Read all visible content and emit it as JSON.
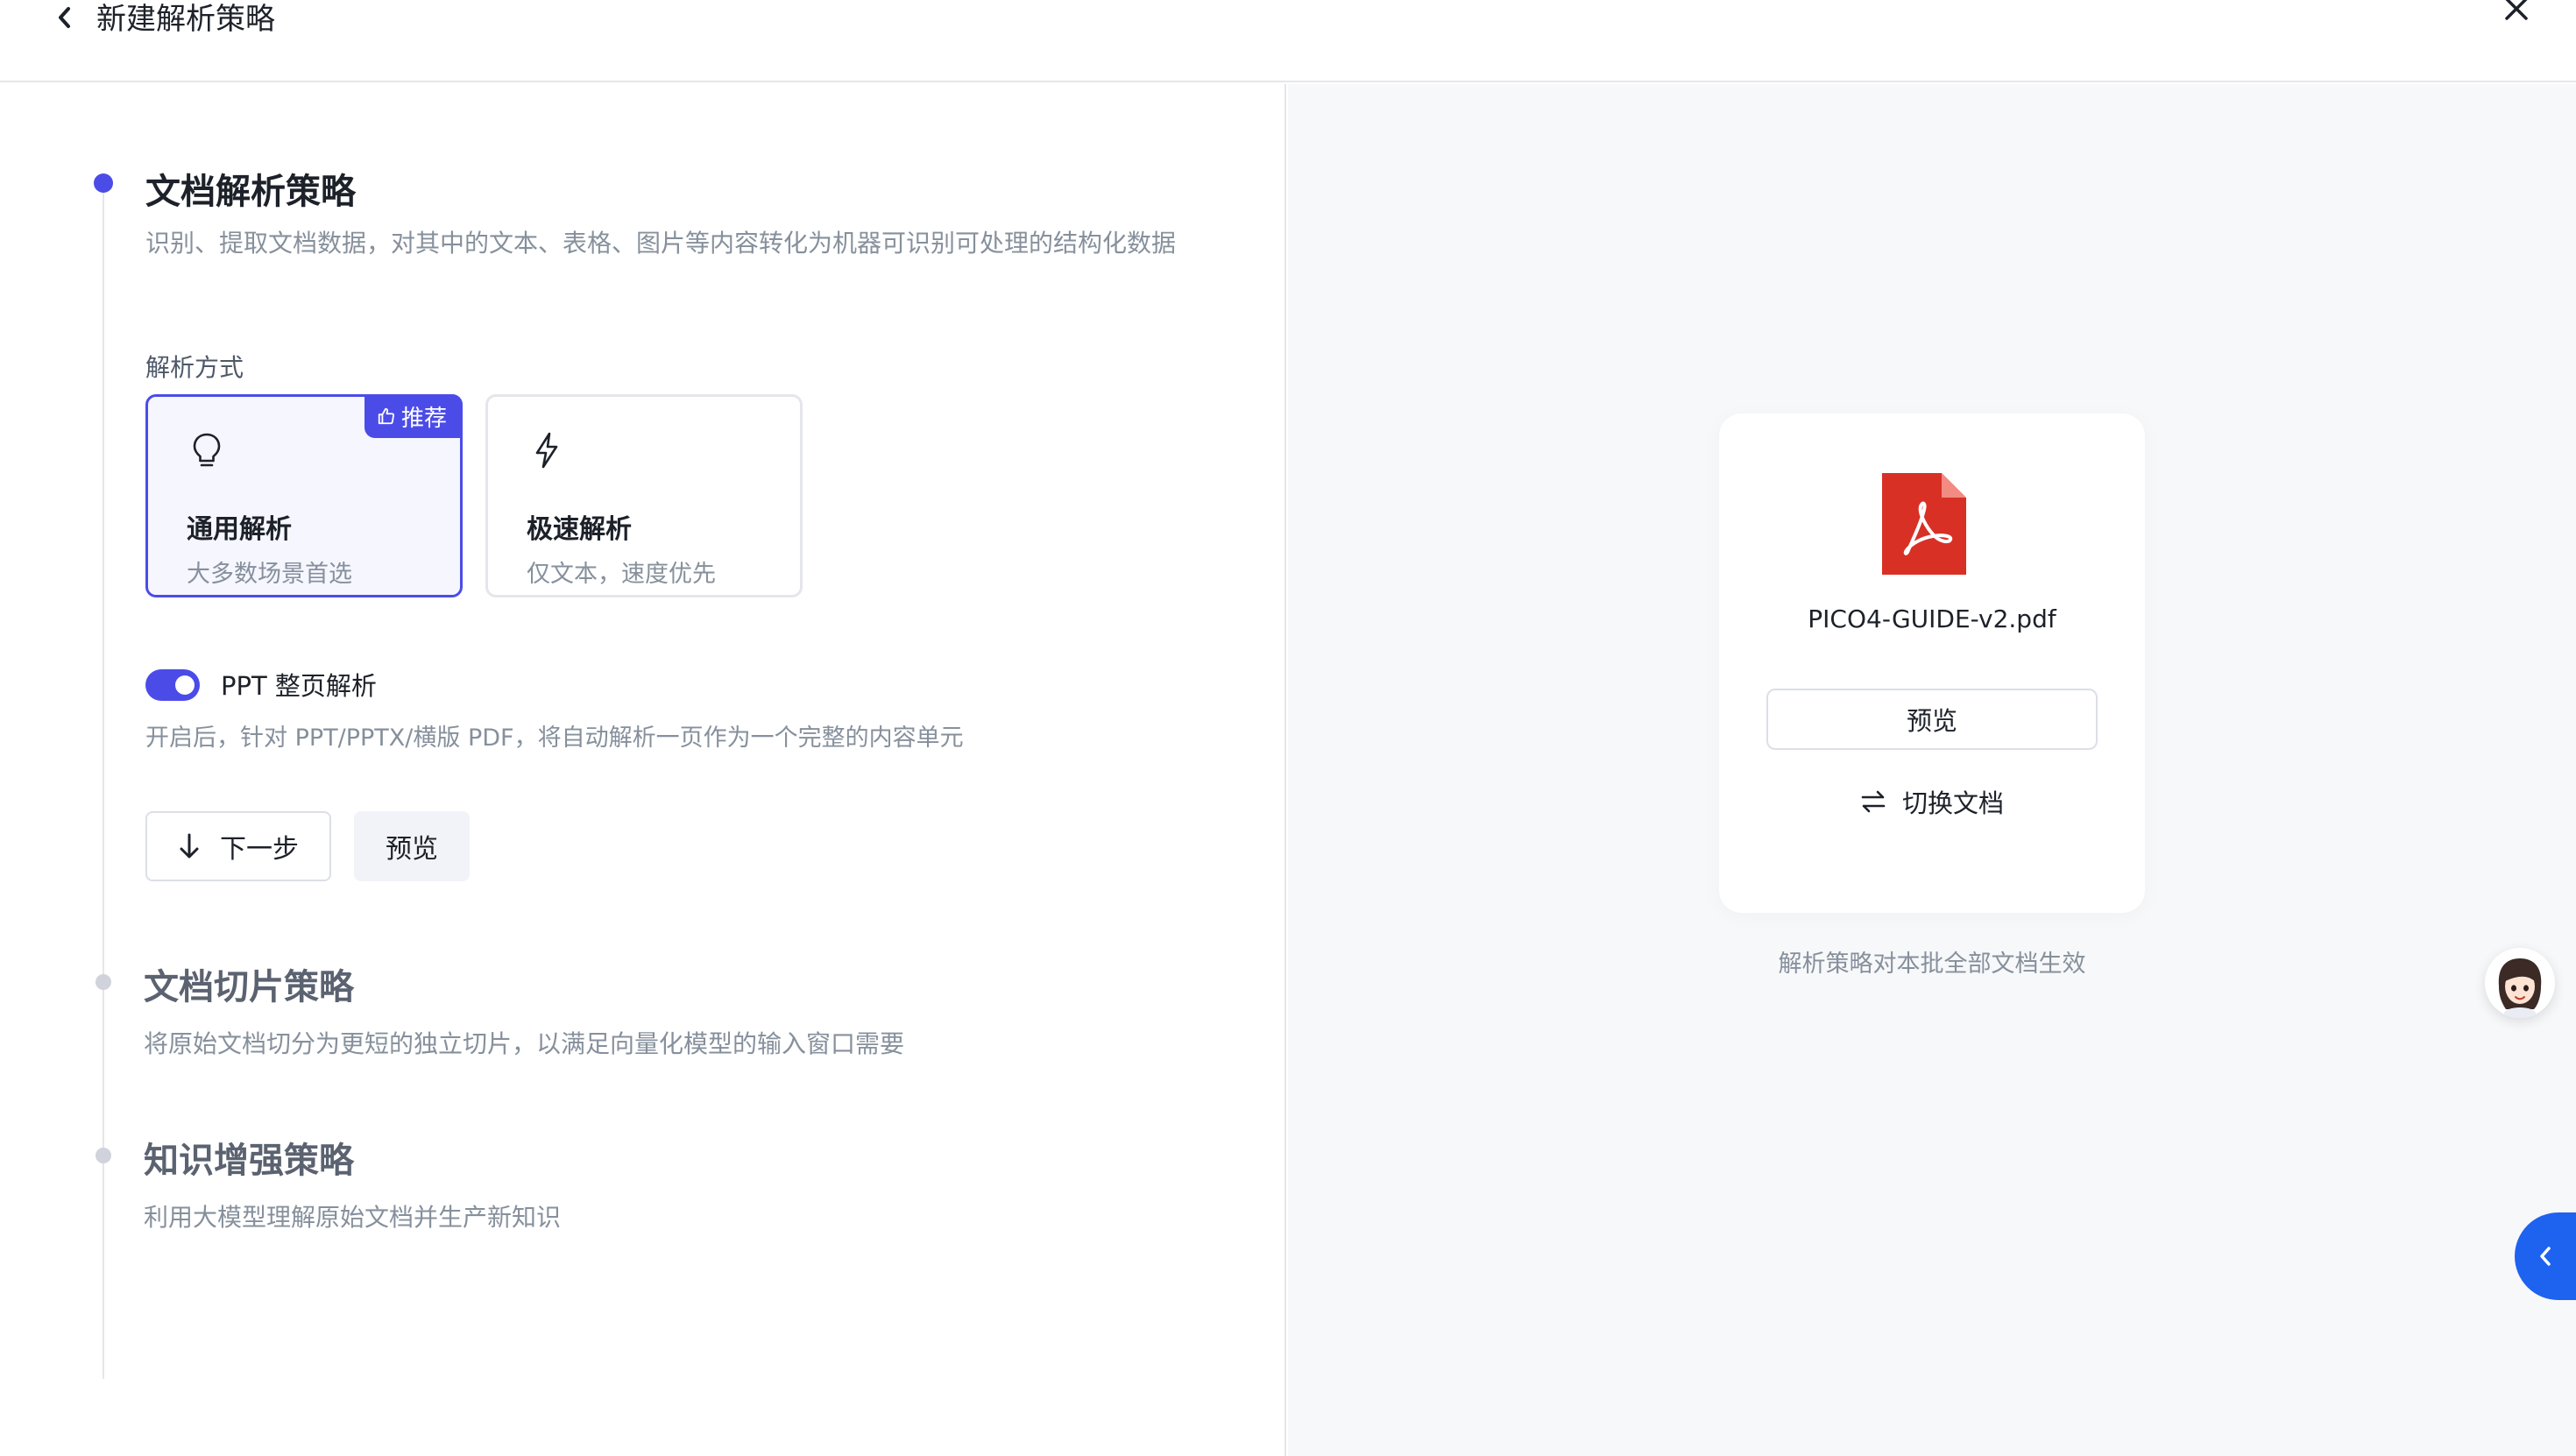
{
  "header": {
    "title": "新建解析策略"
  },
  "steps": [
    {
      "title": "文档解析策略",
      "description": "识别、提取文档数据，对其中的文本、表格、图片等内容转化为机器可识别可处理的结构化数据"
    },
    {
      "title": "文档切片策略",
      "description": "将原始文档切分为更短的独立切片，以满足向量化模型的输入窗口需要"
    },
    {
      "title": "知识增强策略",
      "description": "利用大模型理解原始文档并生产新知识"
    }
  ],
  "parse": {
    "mode_label": "解析方式",
    "options": [
      {
        "title": "通用解析",
        "subtitle": "大多数场景首选",
        "badge": "推荐",
        "icon": "lightbulb-icon",
        "selected": true
      },
      {
        "title": "极速解析",
        "subtitle": "仅文本，速度优先",
        "icon": "lightning-icon",
        "selected": false
      }
    ],
    "ppt_toggle": {
      "label": "PPT 整页解析",
      "on": true,
      "description": "开启后，针对 PPT/PPTX/横版 PDF，将自动解析一页作为一个完整的内容单元"
    },
    "buttons": {
      "next": "下一步",
      "preview": "预览"
    }
  },
  "document": {
    "file_name": "PICO4-GUIDE-v2.pdf",
    "preview_label": "预览",
    "switch_label": "切换文档",
    "note": "解析策略对本批全部文档生效"
  },
  "colors": {
    "accent": "#4b4ce8",
    "pdf_red": "#d93025",
    "side_button": "#1e62f0"
  }
}
